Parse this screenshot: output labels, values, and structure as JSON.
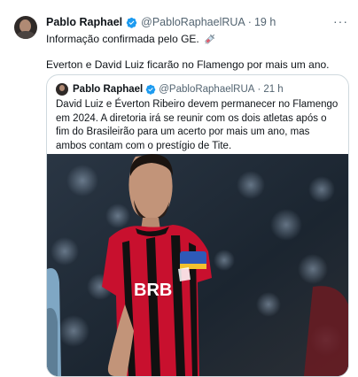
{
  "post": {
    "author_name": "Pablo Raphael",
    "author_handle": "@PabloRaphaelRUA",
    "separator": "·",
    "time": "19 h",
    "text_line1": "Informação confirmada pelo GE.",
    "text_line2": "Everton e David Luiz ficarão no Flamengo por mais um ano.",
    "more_icon": "more-horizontal-icon",
    "emoji_icon": "syringe-emoji"
  },
  "quote": {
    "author_name": "Pablo Raphael",
    "author_handle": "@PabloRaphaelRUA",
    "separator": "·",
    "time": "21 h",
    "text": "David Luiz e Éverton Ribeiro devem permanecer no Flamengo em 2024. A diretoria irá se reunir com os dois atletas após o fim do Brasileirão para um acerto por mais um ano, mas ambos contam com o prestígio de Tite.",
    "image_jersey_sponsor": "BRB"
  },
  "colors": {
    "verified": "#1d9bf0",
    "secondary_text": "#536471",
    "border": "#cfd9de",
    "jersey_red": "#c8102e",
    "jersey_black": "#111111"
  }
}
